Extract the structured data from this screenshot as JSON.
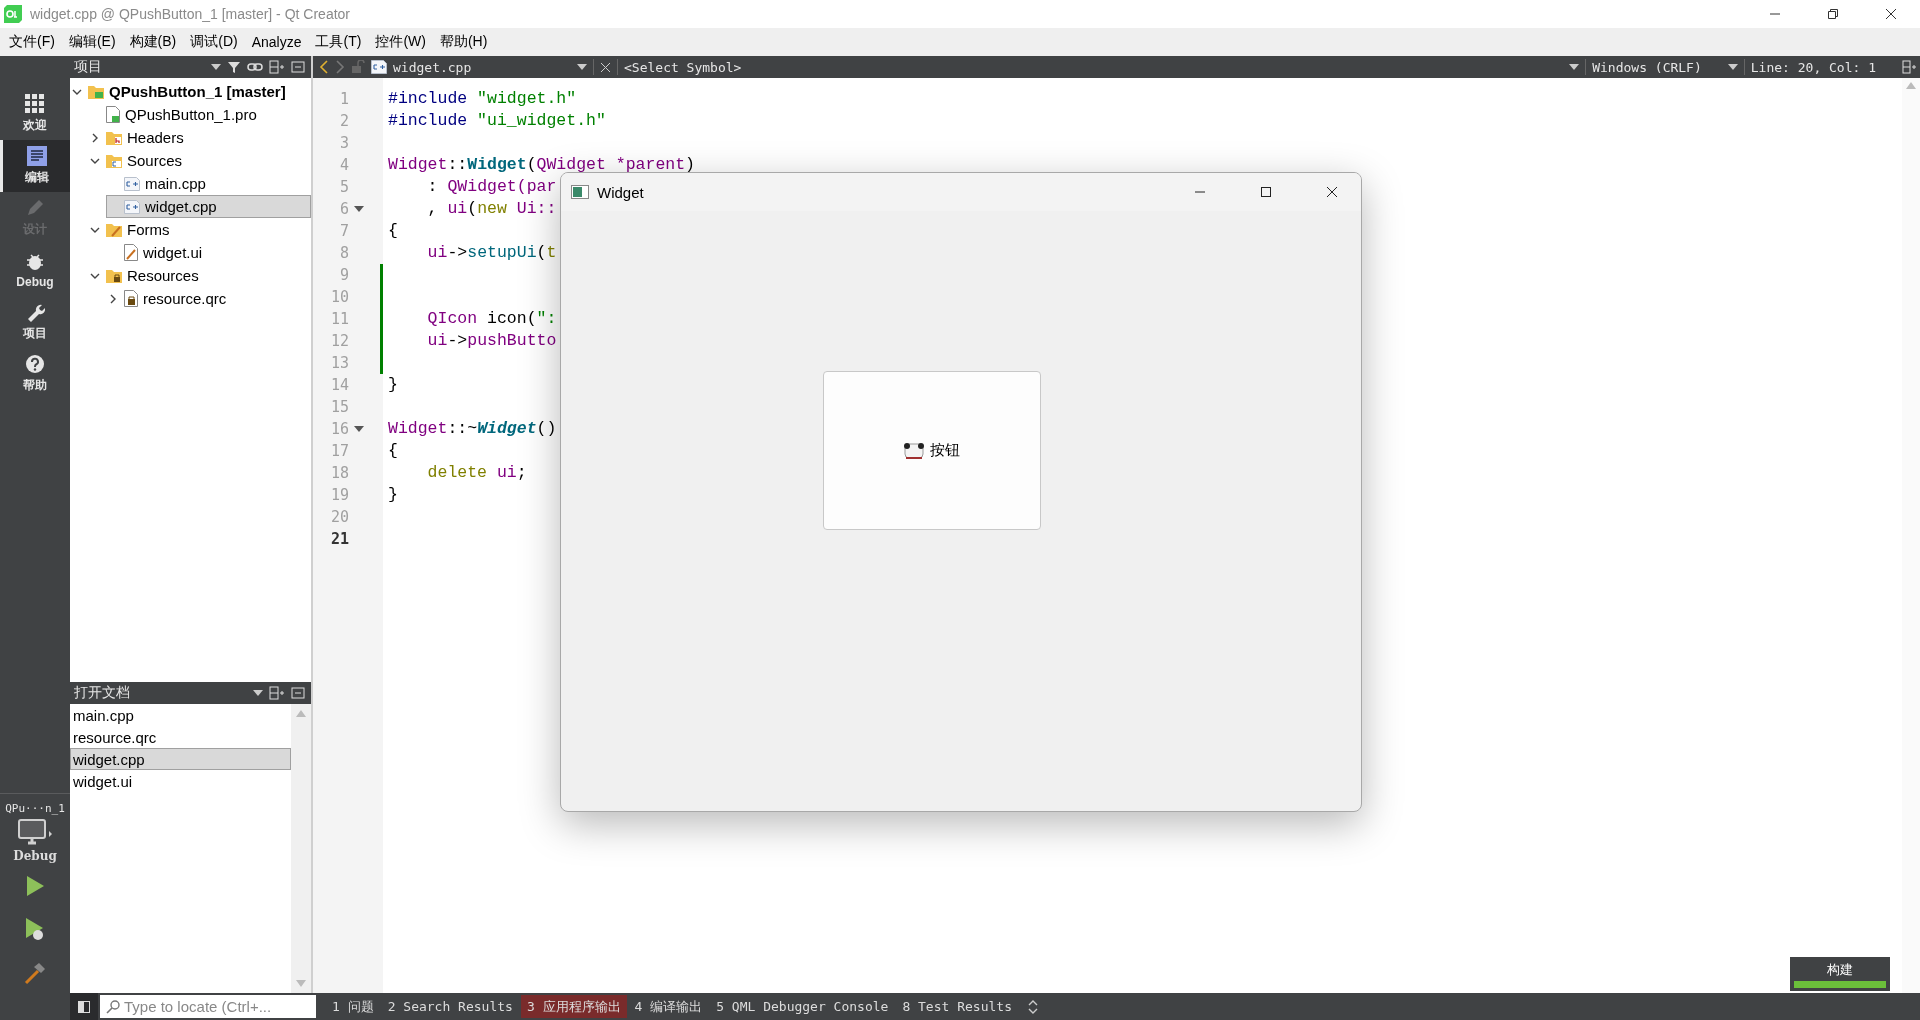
{
  "window": {
    "title": "widget.cpp @ QPushButton_1 [master] - Qt Creator"
  },
  "menu": [
    "文件(F)",
    "编辑(E)",
    "构建(B)",
    "调试(D)",
    "Analyze",
    "工具(T)",
    "控件(W)",
    "帮助(H)"
  ],
  "modes": [
    {
      "label": "欢迎",
      "selected": false,
      "disabled": false
    },
    {
      "label": "编辑",
      "selected": true,
      "disabled": false
    },
    {
      "label": "设计",
      "selected": false,
      "disabled": true
    },
    {
      "label": "Debug",
      "selected": false,
      "disabled": false
    },
    {
      "label": "项目",
      "selected": false,
      "disabled": false
    },
    {
      "label": "帮助",
      "selected": false,
      "disabled": false
    }
  ],
  "kit": {
    "name": "QPu···n_1",
    "build": "Debug"
  },
  "project_pane": {
    "title": "项目",
    "tree": [
      {
        "label": "QPushButton_1 [master]",
        "kind": "project",
        "expanded": true,
        "selected": false,
        "children": [
          {
            "label": "QPushButton_1.pro",
            "kind": "pro",
            "selected": false
          },
          {
            "label": "Headers",
            "kind": "folder-h",
            "expanded": false,
            "selected": false
          },
          {
            "label": "Sources",
            "kind": "folder-src",
            "expanded": true,
            "selected": false,
            "children": [
              {
                "label": "main.cpp",
                "kind": "cpp",
                "selected": false
              },
              {
                "label": "widget.cpp",
                "kind": "cpp",
                "selected": true
              }
            ]
          },
          {
            "label": "Forms",
            "kind": "folder-forms",
            "expanded": true,
            "selected": false,
            "children": [
              {
                "label": "widget.ui",
                "kind": "ui",
                "selected": false
              }
            ]
          },
          {
            "label": "Resources",
            "kind": "folder-res",
            "expanded": true,
            "selected": false,
            "children": [
              {
                "label": "resource.qrc",
                "kind": "qrc",
                "expanded": false,
                "selected": false
              }
            ]
          }
        ]
      }
    ]
  },
  "open_documents": {
    "title": "打开文档",
    "items": [
      {
        "label": "main.cpp",
        "selected": false
      },
      {
        "label": "resource.qrc",
        "selected": false
      },
      {
        "label": "widget.cpp",
        "selected": true
      },
      {
        "label": "widget.ui",
        "selected": false
      }
    ]
  },
  "editor": {
    "file": "widget.cpp",
    "symbol": "<Select Symbol>",
    "line_ending": "Windows (CRLF)",
    "position": "Line: 20, Col: 1",
    "lines": [
      {
        "number": "1",
        "tokens": [
          {
            "text": "#include",
            "kind": "preproc"
          },
          {
            "text": " \"widget.h\"",
            "kind": "string"
          }
        ],
        "fold": false,
        "changed": false,
        "current": false
      },
      {
        "number": "2",
        "tokens": [
          {
            "text": "#include",
            "kind": "preproc"
          },
          {
            "text": " \"ui_widget.h\"",
            "kind": "string"
          }
        ],
        "fold": false,
        "changed": false,
        "current": false
      },
      {
        "number": "3",
        "fold": false,
        "changed": false,
        "current": false
      },
      {
        "number": "4",
        "tokens": [
          {
            "text": "Widget",
            "kind": "type"
          },
          {
            "text": "::",
            "kind": "plain"
          },
          {
            "text": "Widget",
            "kind": "func"
          },
          {
            "text": "(",
            "kind": "plain"
          },
          {
            "text": "QWidget *parent",
            "kind": "type"
          },
          {
            "text": ")",
            "kind": "plain"
          }
        ],
        "fold": false,
        "changed": false,
        "current": false
      },
      {
        "number": "5",
        "tokens": [
          {
            "text": "    : ",
            "kind": "plain"
          },
          {
            "text": "QWidget(par",
            "kind": "type"
          }
        ],
        "fold": false,
        "changed": false,
        "current": false
      },
      {
        "number": "6",
        "tokens": [
          {
            "text": "    , ",
            "kind": "plain"
          },
          {
            "text": "ui",
            "kind": "member"
          },
          {
            "text": "(",
            "kind": "plain"
          },
          {
            "text": "new",
            "kind": "keyword"
          },
          {
            "text": " Ui::",
            "kind": "type"
          }
        ],
        "fold": true,
        "changed": false,
        "current": false
      },
      {
        "number": "7",
        "tokens": [
          {
            "text": "{",
            "kind": "plain"
          }
        ],
        "fold": false,
        "changed": false,
        "current": false
      },
      {
        "number": "8",
        "tokens": [
          {
            "text": "    ui",
            "kind": "member"
          },
          {
            "text": "->",
            "kind": "plain"
          },
          {
            "text": "setupUi",
            "kind": "call"
          },
          {
            "text": "(",
            "kind": "plain"
          },
          {
            "text": "t",
            "kind": "keyword"
          }
        ],
        "fold": false,
        "changed": false,
        "current": false
      },
      {
        "number": "9",
        "fold": false,
        "changed": true,
        "current": false
      },
      {
        "number": "10",
        "fold": false,
        "changed": true,
        "current": false
      },
      {
        "number": "11",
        "tokens": [
          {
            "text": "    QIcon",
            "kind": "type"
          },
          {
            "text": " icon(",
            "kind": "plain"
          },
          {
            "text": "\":",
            "kind": "string"
          }
        ],
        "fold": false,
        "changed": true,
        "current": false
      },
      {
        "number": "12",
        "tokens": [
          {
            "text": "    ui",
            "kind": "member"
          },
          {
            "text": "->",
            "kind": "plain"
          },
          {
            "text": "pushButto",
            "kind": "member"
          }
        ],
        "fold": false,
        "changed": true,
        "current": false
      },
      {
        "number": "13",
        "fold": false,
        "changed": true,
        "current": false
      },
      {
        "number": "14",
        "tokens": [
          {
            "text": "}",
            "kind": "plain"
          }
        ],
        "fold": false,
        "changed": false,
        "current": false
      },
      {
        "number": "15",
        "fold": false,
        "changed": false,
        "current": false
      },
      {
        "number": "16",
        "tokens": [
          {
            "text": "Widget",
            "kind": "type"
          },
          {
            "text": "::~",
            "kind": "plain"
          },
          {
            "text": "Widget",
            "kind": "dtor"
          },
          {
            "text": "()",
            "kind": "plain"
          }
        ],
        "fold": true,
        "changed": false,
        "current": false
      },
      {
        "number": "17",
        "tokens": [
          {
            "text": "{",
            "kind": "plain"
          }
        ],
        "fold": false,
        "changed": false,
        "current": false
      },
      {
        "number": "18",
        "tokens": [
          {
            "text": "    delete",
            "kind": "keyword"
          },
          {
            "text": " ui",
            "kind": "member"
          },
          {
            "text": ";",
            "kind": "plain"
          }
        ],
        "fold": false,
        "changed": false,
        "current": false
      },
      {
        "number": "19",
        "tokens": [
          {
            "text": "}",
            "kind": "plain"
          }
        ],
        "fold": false,
        "changed": false,
        "current": false
      },
      {
        "number": "20",
        "fold": false,
        "changed": false,
        "current": false
      },
      {
        "number": "21",
        "fold": false,
        "changed": false,
        "current": true
      }
    ]
  },
  "app_window": {
    "title": "Widget",
    "button": {
      "label": "按钮"
    }
  },
  "status_bar": {
    "locator_placeholder": "Type to locate (Ctrl+...",
    "panes": [
      {
        "label": "1 问题",
        "selected": false
      },
      {
        "label": "2 Search Results",
        "selected": false
      },
      {
        "label": "3 应用程序输出",
        "selected": true
      },
      {
        "label": "4 编译输出",
        "selected": false
      },
      {
        "label": "5 QML Debugger Console",
        "selected": false
      },
      {
        "label": "8 Test Results",
        "selected": false
      }
    ]
  },
  "build_progress": {
    "label": "构建",
    "level": 1
  }
}
